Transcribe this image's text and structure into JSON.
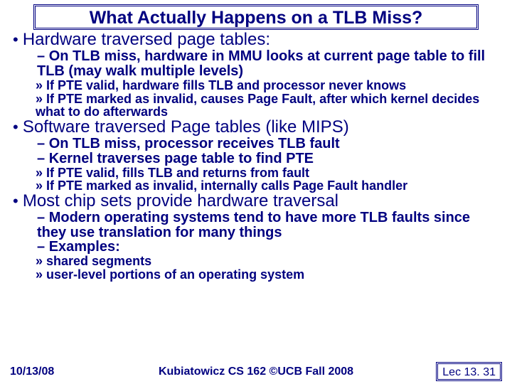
{
  "title": "What Actually Happens on a TLB Miss?",
  "b1": {
    "head": "Hardware traversed page tables:",
    "s1": "On TLB miss, hardware in MMU looks at current page table to fill TLB (may walk multiple levels)",
    "s1a": "If PTE valid, hardware fills TLB and processor never knows",
    "s1b": "If PTE marked as invalid, causes Page Fault, after which kernel decides what to do afterwards"
  },
  "b2": {
    "head": "Software traversed Page tables (like MIPS)",
    "s1": "On TLB miss, processor receives TLB fault",
    "s2": "Kernel traverses page table to find PTE",
    "s2a": "If PTE valid, fills TLB and returns from fault",
    "s2b": "If PTE marked as invalid, internally calls Page Fault handler"
  },
  "b3": {
    "head": "Most chip sets provide hardware traversal",
    "s1": "Modern operating systems tend to have more TLB faults since they use translation for many things",
    "s2": "Examples:",
    "s2a": "shared segments",
    "s2b": "user-level portions of an operating system"
  },
  "footer": {
    "date": "10/13/08",
    "center": "Kubiatowicz CS 162 ©UCB Fall 2008",
    "page": "Lec 13. 31"
  }
}
